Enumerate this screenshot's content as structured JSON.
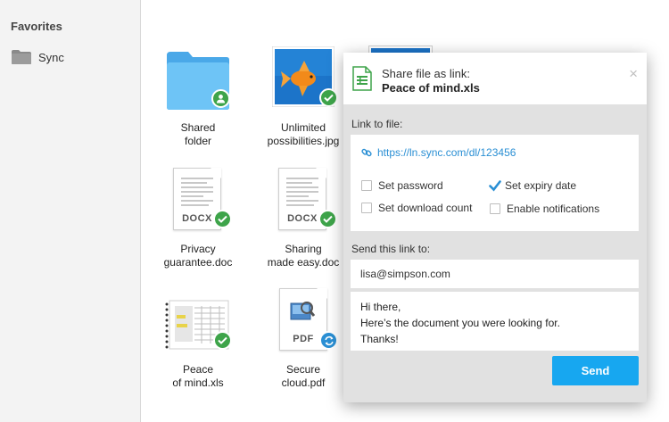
{
  "sidebar": {
    "heading": "Favorites",
    "items": [
      {
        "label": "Sync",
        "icon": "folder-icon"
      }
    ]
  },
  "files": [
    {
      "name": "Shared\nfolder",
      "type": "folder",
      "badge": "user"
    },
    {
      "name": "Unlimited\npossibilities.jpg",
      "type": "image",
      "badge": "check"
    },
    {
      "name": "Privacy\nguarantee.doc",
      "type": "doc",
      "ext": "DOCX",
      "badge": "check"
    },
    {
      "name": "Sharing\nmade easy.doc",
      "type": "doc",
      "ext": "DOCX",
      "badge": "check"
    },
    {
      "name": "Peace\nof mind.xls",
      "type": "sheet",
      "badge": "check"
    },
    {
      "name": "Secure\ncloud.pdf",
      "type": "pdf",
      "ext": "PDF",
      "badge": "sync"
    }
  ],
  "dialog": {
    "title": "Share file as link:",
    "filename": "Peace of mind.xls",
    "close_label": "×",
    "link_label": "Link to file:",
    "link_url": "https://ln.sync.com/dl/123456",
    "options": {
      "set_password": {
        "label": "Set password",
        "checked": false
      },
      "set_expiry": {
        "label": "Set expiry date",
        "checked": true
      },
      "set_download_count": {
        "label": "Set download count",
        "checked": false
      },
      "enable_notifications": {
        "label": "Enable notifications",
        "checked": false
      }
    },
    "send_label": "Send this link to:",
    "email": "lisa@simpson.com",
    "message": {
      "line1": "Hi there,",
      "line2": "Here’s the document you were looking for.",
      "line3": "Thanks!"
    },
    "send_button": "Send"
  },
  "colors": {
    "accent": "#17a7f0",
    "link": "#2a8fd4",
    "success": "#3ea44a",
    "folder": "#5bbcf4"
  }
}
